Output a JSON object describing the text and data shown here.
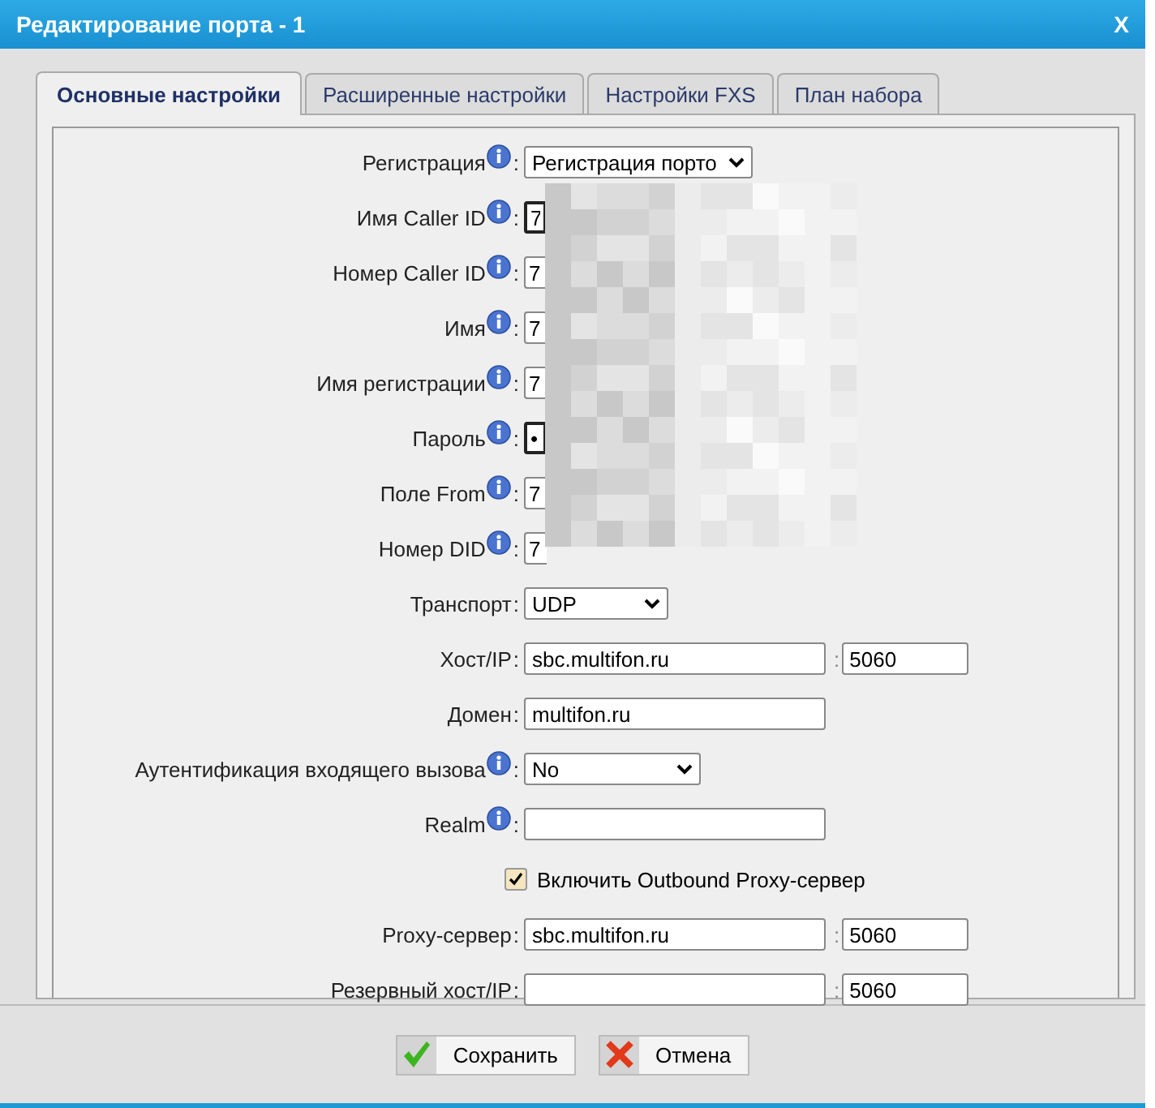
{
  "window": {
    "title": "Редактирование порта - 1",
    "close": "X"
  },
  "tabs": [
    {
      "label": "Основные настройки",
      "selected": true
    },
    {
      "label": "Расширенные настройки",
      "selected": false
    },
    {
      "label": "Настройки FXS",
      "selected": false
    },
    {
      "label": "План набора",
      "selected": false
    }
  ],
  "fields": [
    {
      "kind": "select",
      "label": "Регистрация",
      "info": true,
      "colon": ":",
      "value": "Регистрация порто"
    },
    {
      "kind": "masked",
      "label": "Имя Caller ID",
      "info": true,
      "colon": ":",
      "value": "7"
    },
    {
      "kind": "masked",
      "label": "Номер Caller ID",
      "info": true,
      "colon": ":",
      "value": "7"
    },
    {
      "kind": "masked",
      "label": "Имя",
      "info": true,
      "colon": ":",
      "value": "7"
    },
    {
      "kind": "masked",
      "label": "Имя регистрации",
      "info": true,
      "colon": ":",
      "value": "7"
    },
    {
      "kind": "masked",
      "label": "Пароль",
      "info": true,
      "colon": ":",
      "value": "•"
    },
    {
      "kind": "masked",
      "label": "Поле From",
      "info": true,
      "colon": ":",
      "value": "7"
    },
    {
      "kind": "masked",
      "label": "Номер DID",
      "info": true,
      "colon": ":",
      "value": "7"
    },
    {
      "kind": "select",
      "label": "Транспорт",
      "colon": ":",
      "value": "UDP"
    },
    {
      "kind": "text",
      "label": "Хост/IP",
      "colon": ":",
      "value": "sbc.multifon.ru",
      "port_colon": ":",
      "port": "5060"
    },
    {
      "kind": "text",
      "label": "Домен",
      "colon": ":",
      "value": "multifon.ru"
    },
    {
      "kind": "select",
      "label": "Аутентификация входящего вызова",
      "info": true,
      "colon": ":",
      "value": "No"
    },
    {
      "kind": "text",
      "label": "Realm",
      "info": true,
      "colon": ":"
    },
    {
      "kind": "checkbox",
      "label": "Включить Outbound Proxy-сервер",
      "checked": true
    },
    {
      "kind": "text",
      "label": "Proxy-сервер",
      "colon": ":",
      "value": "sbc.multifon.ru",
      "port_colon": ":",
      "port": "5060"
    },
    {
      "kind": "text",
      "label": "Резервный хост/IP",
      "colon": ":",
      "port_colon": ":",
      "port": "5060"
    }
  ],
  "buttons": [
    {
      "kind": "save",
      "label": "Сохранить"
    },
    {
      "kind": "cancel",
      "label": "Отмена"
    }
  ]
}
